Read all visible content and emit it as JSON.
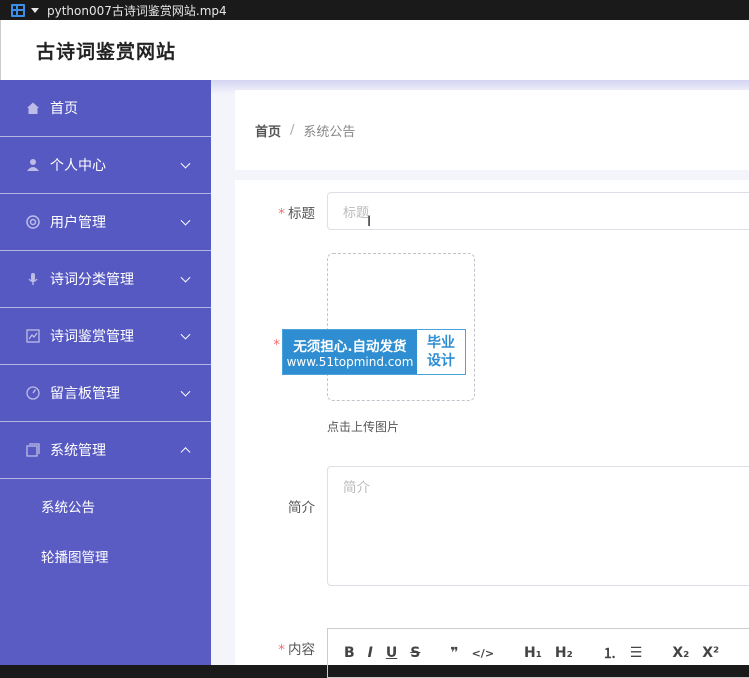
{
  "window": {
    "file_name": "python007古诗词鉴赏网站.mp4"
  },
  "header": {
    "site_title": "古诗词鉴赏网站"
  },
  "sidebar": {
    "items": [
      {
        "label": "首页",
        "icon": "home-icon",
        "expandable": false
      },
      {
        "label": "个人中心",
        "icon": "user-icon",
        "expandable": true
      },
      {
        "label": "用户管理",
        "icon": "users-icon",
        "expandable": true
      },
      {
        "label": "诗词分类管理",
        "icon": "microphone-icon",
        "expandable": true
      },
      {
        "label": "诗词鉴赏管理",
        "icon": "chart-icon",
        "expandable": true
      },
      {
        "label": "留言板管理",
        "icon": "dial-icon",
        "expandable": true
      },
      {
        "label": "系统管理",
        "icon": "window-icon",
        "expandable": true,
        "expanded": true
      }
    ],
    "sub_items": [
      {
        "label": "系统公告"
      },
      {
        "label": "轮播图管理"
      }
    ]
  },
  "breadcrumb": {
    "home": "首页",
    "separator": "/",
    "current": "系统公告"
  },
  "form": {
    "title_label": "标题",
    "title_placeholder": "标题",
    "required_mark": "*",
    "upload_hint": "点击上传图片",
    "summary_label": "简介",
    "summary_placeholder": "简介",
    "content_label": "内容"
  },
  "editor_toolbar": {
    "bold": "B",
    "italic": "I",
    "underline": "U",
    "strike": "S",
    "quote": "❞",
    "code": "</>",
    "h1": "H₁",
    "h2": "H₂",
    "ordered_list": "⒈",
    "bullet_list": "☰",
    "subscript": "X₂",
    "superscript": "X²"
  },
  "watermark": {
    "line1": "无须担心.自动发货",
    "line2": "www.51topmind.com",
    "right_line1": "毕业",
    "right_line2": "设计"
  },
  "colors": {
    "sidebar": "#5a5cc4",
    "required": "#f56c6c",
    "watermark_blue": "#2f8ed1"
  }
}
